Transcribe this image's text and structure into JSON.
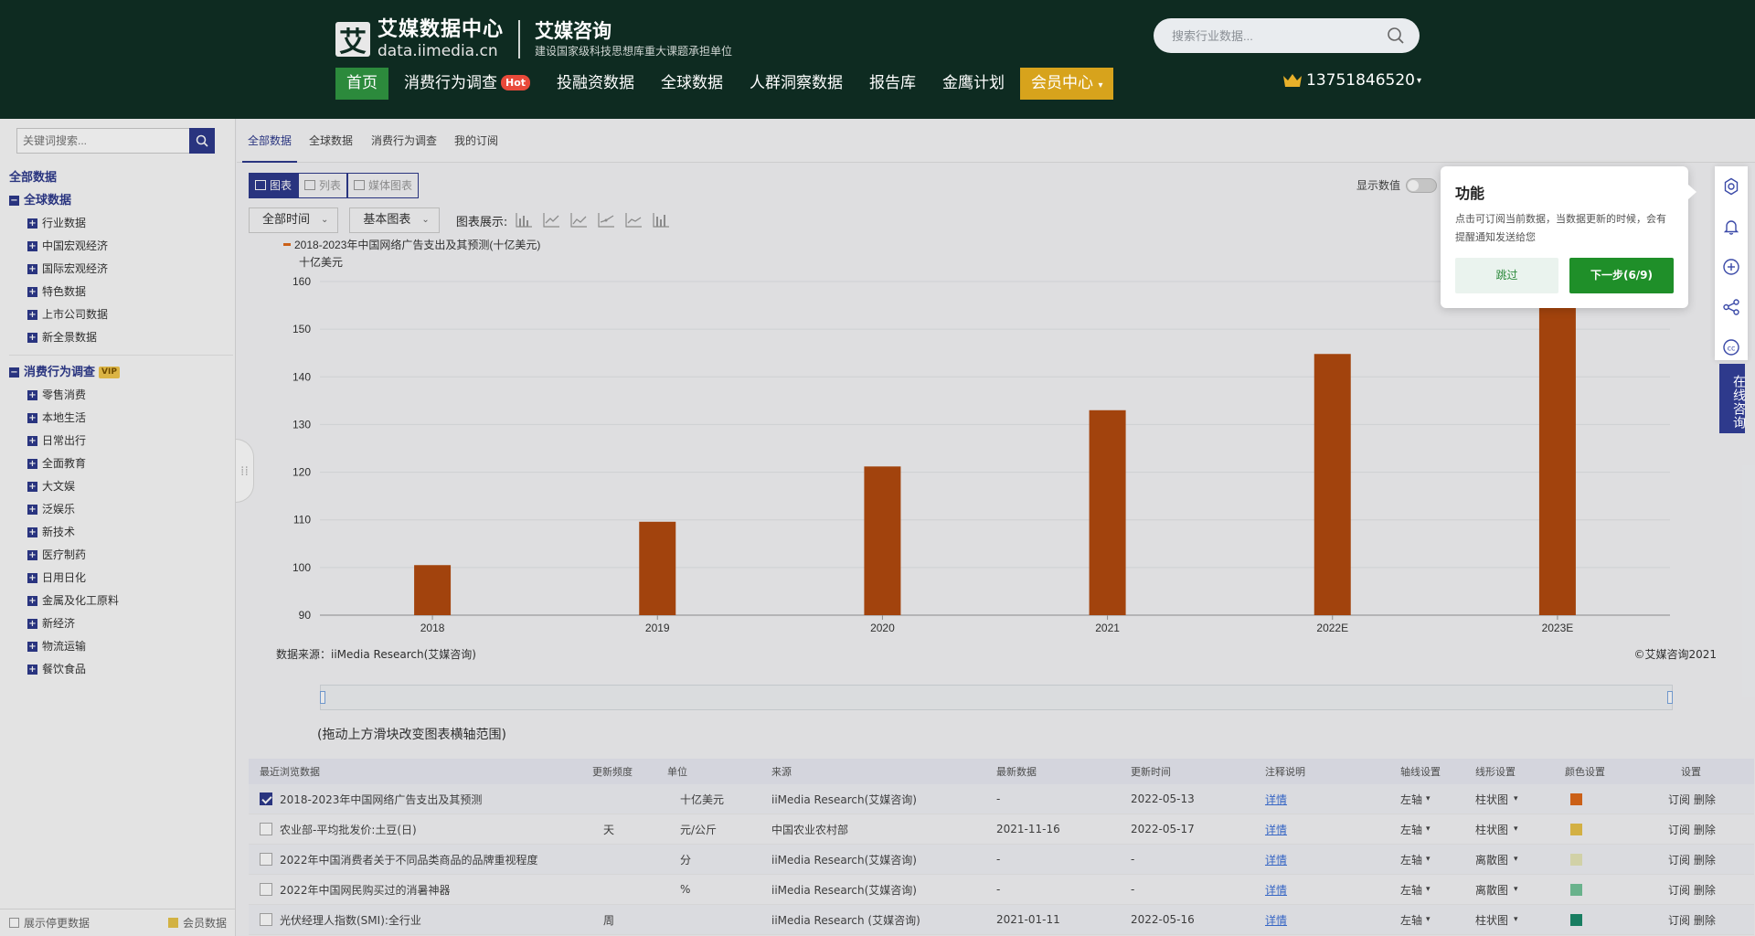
{
  "brand": {
    "mark": "艾",
    "title": "艾媒数据中心",
    "domain": "data.iimedia.cn",
    "company": "艾媒咨询",
    "slogan": "建设国家级科技思想库重大课题承担单位"
  },
  "header_search": {
    "placeholder": "搜索行业数据..."
  },
  "nav": {
    "items": [
      "首页",
      "消费行为调查",
      "投融资数据",
      "全球数据",
      "人群洞察数据",
      "报告库",
      "金鹰计划",
      "会员中心"
    ],
    "hot_badge": "Hot",
    "user_phone": "13751846520"
  },
  "sidebar": {
    "search_placeholder": "关键词搜索...",
    "root": "全部数据",
    "groups": [
      {
        "label": "全球数据",
        "items": [
          "行业数据",
          "中国宏观经济",
          "国际宏观经济",
          "特色数据",
          "上市公司数据",
          "新全景数据"
        ]
      },
      {
        "label": "消费行为调查",
        "badge": "VIP",
        "items": [
          "零售消费",
          "本地生活",
          "日常出行",
          "全面教育",
          "大文娱",
          "泛娱乐",
          "新技术",
          "医疗制药",
          "日用日化",
          "金属及化工原料",
          "新经济",
          "物流运输",
          "餐饮食品"
        ]
      }
    ],
    "footer_left": "展示停更数据",
    "footer_right": "会员数据"
  },
  "tabs": [
    "全部数据",
    "全球数据",
    "消费行为调查",
    "我的订阅"
  ],
  "view_toggle": [
    "图表",
    "列表",
    "媒体图表"
  ],
  "filters": {
    "time": "全部时间",
    "chart_kind": "基本图表",
    "chart_types_label": "图表展示:"
  },
  "show_data_label": "显示数值",
  "chart_data": {
    "type": "bar",
    "legend": "2018-2023年中国网络广告支出及其预测(十亿美元)",
    "ylabel": "十亿美元",
    "categories": [
      "2018",
      "2019",
      "2020",
      "2021",
      "2022E",
      "2023E"
    ],
    "values": [
      100.5,
      109.6,
      121.2,
      133.0,
      144.8,
      157.5
    ],
    "ylim": [
      90,
      160
    ],
    "yticks": [
      90,
      100,
      110,
      120,
      130,
      140,
      150,
      160
    ],
    "color": "#b34a0f",
    "grid": true
  },
  "source_text": "数据来源：iiMedia Research(艾媒咨询)",
  "copyright_text": "©艾媒咨询2021",
  "slider_hint": "(拖动上方滑块改变图表横轴范围)",
  "table": {
    "headers": [
      "最近浏览数据",
      "更新频度",
      "单位",
      "来源",
      "最新数据",
      "更新时间",
      "注释说明",
      "轴线设置",
      "线形设置",
      "颜色设置",
      "设置"
    ],
    "rows": [
      {
        "checked": true,
        "name": "2018-2023年中国网络广告支出及其预测",
        "freq": "",
        "unit": "十亿美元",
        "source": "iiMedia Research(艾媒咨询)",
        "latest": "-",
        "updated": "2022-05-13",
        "note": "详情",
        "axis": "左轴",
        "line": "柱状图",
        "color": "#e06a1a",
        "ops": "订阅 删除"
      },
      {
        "checked": false,
        "name": "农业部-平均批发价:土豆(日)",
        "freq": "天",
        "unit": "元/公斤",
        "source": "中国农业农村部",
        "latest": "2021-11-16",
        "updated": "2022-05-17",
        "note": "详情",
        "axis": "左轴",
        "line": "柱状图",
        "color": "#e8c24a",
        "ops": "订阅 删除"
      },
      {
        "checked": false,
        "name": "2022年中国消费者关于不同品类商品的品牌重视程度",
        "freq": "",
        "unit": "分",
        "source": "iiMedia Research(艾媒咨询)",
        "latest": "-",
        "updated": "-",
        "note": "详情",
        "axis": "左轴",
        "line": "离散图",
        "color": "#e6e6b8",
        "ops": "订阅 删除"
      },
      {
        "checked": false,
        "name": "2022年中国网民购买过的消暑神器",
        "freq": "",
        "unit": "%",
        "source": "iiMedia Research(艾媒咨询)",
        "latest": "-",
        "updated": "-",
        "note": "详情",
        "axis": "左轴",
        "line": "离散图",
        "color": "#74c49a",
        "ops": "订阅 删除"
      },
      {
        "checked": false,
        "name": "光伏经理人指数(SMI):全行业",
        "freq": "周",
        "unit": "",
        "source": "iiMedia Research (艾媒咨询)",
        "latest": "2021-01-11",
        "updated": "2022-05-16",
        "note": "详情",
        "axis": "左轴",
        "line": "柱状图",
        "color": "#1b8a6b",
        "ops": "订阅 删除"
      }
    ]
  },
  "tour": {
    "title": "功能",
    "body": "点击可订阅当前数据，当数据更新的时候，会有提醒通知发送给您",
    "skip": "跳过",
    "next": "下一步(6/9)"
  },
  "side_tools": [
    "gear-icon",
    "bell-icon",
    "plus-icon",
    "share-icon",
    "cc-icon"
  ],
  "consult": "在线咨询"
}
